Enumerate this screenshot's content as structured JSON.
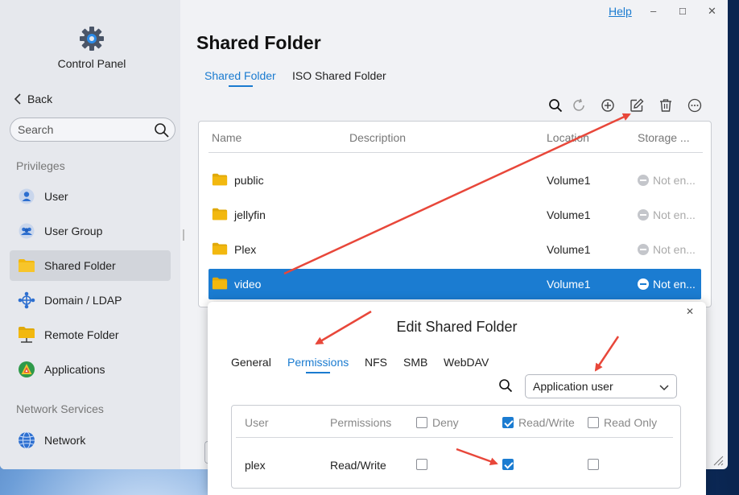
{
  "window": {
    "help_label": "Help",
    "minimize_glyph": "–",
    "maximize_glyph": "☐",
    "close_glyph": "✕"
  },
  "sidebar": {
    "app_title": "Control Panel",
    "back_label": "Back",
    "search_placeholder": "Search",
    "sections": [
      {
        "label": "Privileges",
        "items": [
          {
            "label": "User",
            "icon": "user-icon",
            "active": false
          },
          {
            "label": "User Group",
            "icon": "user-group-icon",
            "active": false
          },
          {
            "label": "Shared Folder",
            "icon": "folder-icon",
            "active": true
          },
          {
            "label": "Domain / LDAP",
            "icon": "domain-network-icon",
            "active": false
          },
          {
            "label": "Remote Folder",
            "icon": "remote-folder-icon",
            "active": false
          },
          {
            "label": "Applications",
            "icon": "applications-icon",
            "active": false
          }
        ]
      },
      {
        "label": "Network Services",
        "items": [
          {
            "label": "Network",
            "icon": "globe-icon",
            "active": false
          }
        ]
      }
    ]
  },
  "main": {
    "title": "Shared Folder",
    "tabs": [
      {
        "label": "Shared Folder",
        "active": true
      },
      {
        "label": "ISO Shared Folder",
        "active": false
      }
    ],
    "toolbar_icons": [
      "search-icon",
      "refresh-icon",
      "add-icon",
      "edit-icon",
      "delete-icon",
      "more-icon"
    ],
    "table": {
      "columns": [
        "Name",
        "Description",
        "Location",
        "Storage ..."
      ],
      "rows": [
        {
          "name": "public",
          "description": "",
          "location": "Volume1",
          "storage": "Not en...",
          "selected": false
        },
        {
          "name": "jellyfin",
          "description": "",
          "location": "Volume1",
          "storage": "Not en...",
          "selected": false
        },
        {
          "name": "Plex",
          "description": "",
          "location": "Volume1",
          "storage": "Not en...",
          "selected": false
        },
        {
          "name": "video",
          "description": "",
          "location": "Volume1",
          "storage": "Not en...",
          "selected": true
        }
      ]
    }
  },
  "dialog": {
    "title": "Edit Shared Folder",
    "close_glyph": "✕",
    "tabs": [
      {
        "label": "General",
        "active": false
      },
      {
        "label": "Permissions",
        "active": true
      },
      {
        "label": "NFS",
        "active": false
      },
      {
        "label": "SMB",
        "active": false
      },
      {
        "label": "WebDAV",
        "active": false
      }
    ],
    "user_type_select": "Application user",
    "permissions_table": {
      "columns": {
        "user": "User",
        "permissions": "Permissions",
        "deny": "Deny",
        "read_write": "Read/Write",
        "read_only": "Read Only"
      },
      "header_checks": {
        "deny": false,
        "read_write": true,
        "read_only": false
      },
      "rows": [
        {
          "user": "plex",
          "permissions": "Read/Write",
          "deny": false,
          "read_write": true,
          "read_only": false
        }
      ]
    }
  },
  "colors": {
    "accent": "#1a7bd0",
    "selected_row": "#1b7cd1",
    "annotation_arrow": "#e8473a",
    "folder_yellow": "#f2b80f"
  }
}
